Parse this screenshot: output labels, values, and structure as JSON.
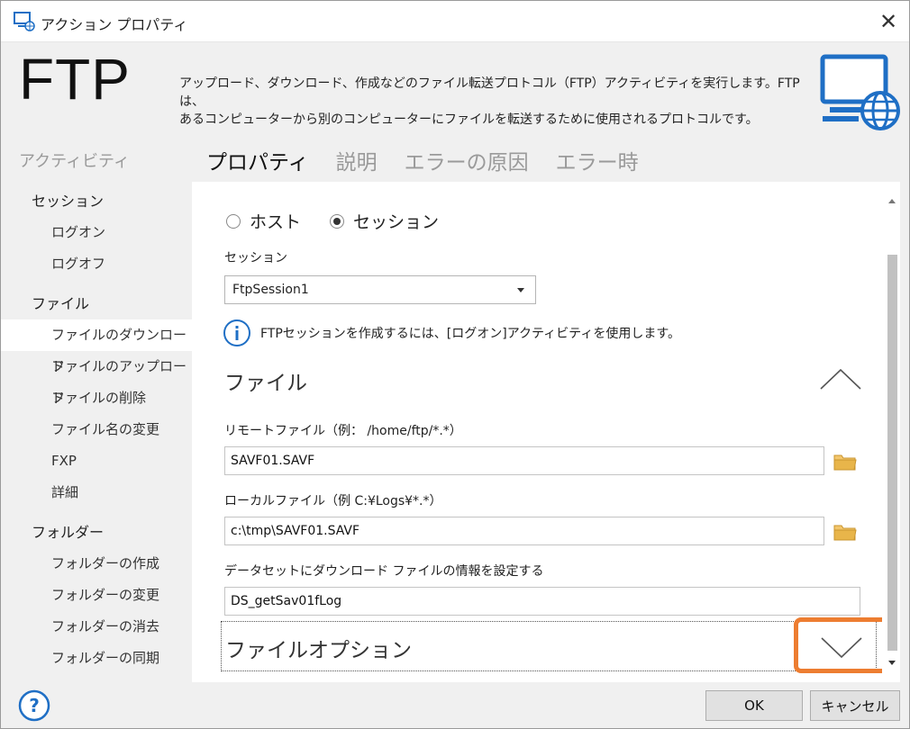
{
  "window": {
    "title": "アクション プロパティ",
    "close_glyph": "✕"
  },
  "header": {
    "title": "FTP",
    "description_line1": "アップロード、ダウンロード、作成などのファイル転送プロトコル（FTP）アクティビティを実行します。FTPは、",
    "description_line2": "あるコンピューターから別のコンピューターにファイルを転送するために使用されるプロトコルです。"
  },
  "sidebar": {
    "heading": "アクティビティ",
    "groups": [
      {
        "label": "セッション",
        "items": [
          "ログオン",
          "ログオフ"
        ]
      },
      {
        "label": "ファイル",
        "items": [
          "ファイルのダウンロード",
          "ファイルのアップロード",
          "ファイルの削除",
          "ファイル名の変更",
          "FXP",
          "詳細"
        ]
      },
      {
        "label": "フォルダー",
        "items": [
          "フォルダーの作成",
          "フォルダーの変更",
          "フォルダーの消去",
          "フォルダーの同期"
        ]
      }
    ],
    "selected_item": "ファイルのダウンロード"
  },
  "tabs": {
    "properties": "プロパティ",
    "description": "説明",
    "error_cause": "エラーの原因",
    "on_error": "エラー時"
  },
  "form": {
    "radio_host": "ホスト",
    "radio_session": "セッション",
    "selected_radio": "session",
    "session_label": "セッション",
    "session_value": "FtpSession1",
    "info_text": "FTPセッションを作成するには、[ログオン]アクティビティを使用します。",
    "file_section_title": "ファイル",
    "remote_file_label": "リモートファイル（例： /home/ftp/*.*）",
    "remote_file_value": "SAVF01.SAVF",
    "local_file_label": "ローカルファイル（例 C:¥Logs¥*.*）",
    "local_file_value": "c:\\tmp\\SAVF01.SAVF",
    "dataset_label": "データセットにダウンロード ファイルの情報を設定する",
    "dataset_value": "DS_getSav01fLog",
    "file_options_title": "ファイルオプション"
  },
  "footer": {
    "help_glyph": "?",
    "ok_label": "OK",
    "cancel_label": "キャンセル"
  },
  "colors": {
    "accent_blue": "#1f6fc5",
    "highlight_orange": "#ed7d31",
    "folder_yellow": "#e8b54a"
  }
}
